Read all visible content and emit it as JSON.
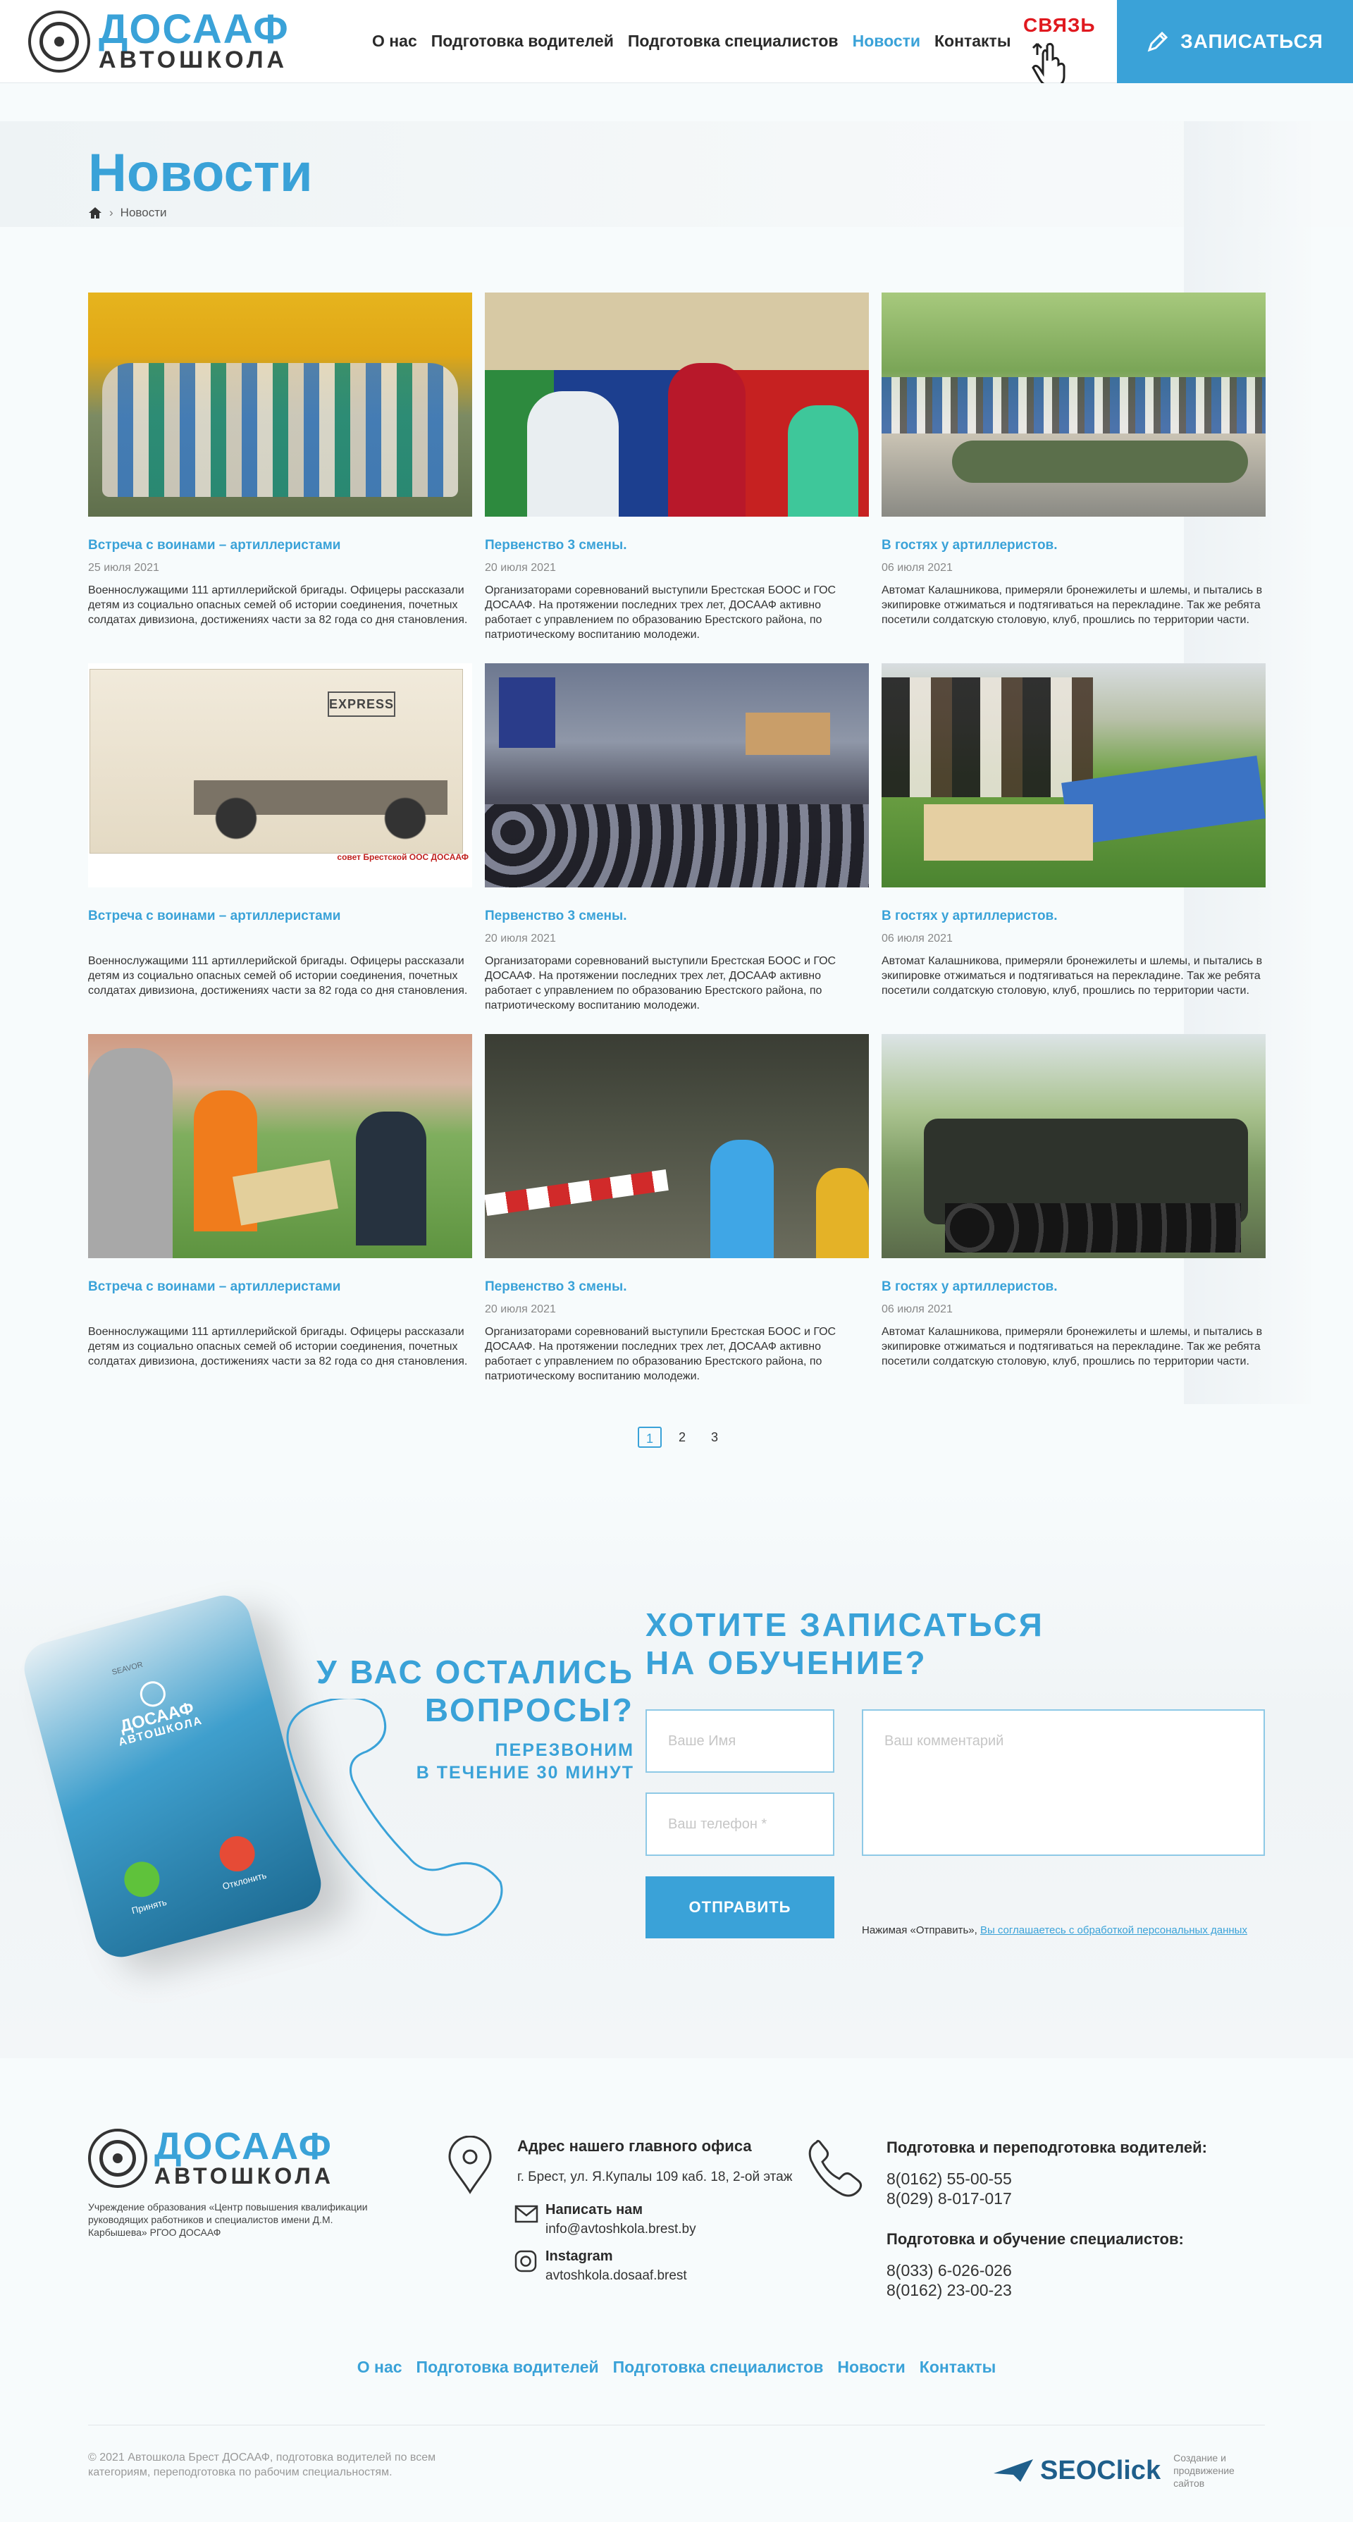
{
  "header": {
    "logo_top": "ДОСААФ",
    "logo_bottom": "АВТОШКОЛА",
    "nav": [
      "О нас",
      "Подготовка водителей",
      "Подготовка специалистов",
      "Новости",
      "Контакты"
    ],
    "contact_label": "СВЯЗЬ",
    "cta_label": "ЗАПИСАТЬСЯ"
  },
  "page": {
    "title": "Новости",
    "breadcrumb_current": "Новости"
  },
  "news": [
    {
      "title": "Встреча с воинами – артиллеристами",
      "date": "25 июля 2021",
      "text": "Военнослужащими 111 артиллерийской бригады. Офицеры рассказали детям из социально опасных семей об истории соединения, почетных солдатах дивизиона, достижениях части за 82 года со дня становления."
    },
    {
      "title": "Первенство 3 смены.",
      "date": "20 июля 2021",
      "text": "Организаторами соревнований выступили Брестская БООС и ГОС ДОСААФ. На протяжении последних трех лет, ДОСААФ активно работает с управлением по образованию Брестского района, по патриотическому воспитанию молодежи."
    },
    {
      "title": "В гостях у артиллеристов.",
      "date": "06 июля 2021",
      "text": "Автомат Калашникова, примеряли бронежилеты и шлемы, и пытались в экипировке отжиматься и подтягиваться на перекладине. Так же ребята посетили солдатскую столовую, клуб, прошлись по территории части."
    },
    {
      "title": "Встреча с воинами – артиллеристами",
      "date": "",
      "text": "Военнослужащими 111 артиллерийской бригады. Офицеры рассказали детям из социально опасных семей об истории соединения, почетных солдатах дивизиона, достижениях части за 82 года со дня становления."
    },
    {
      "title": "Первенство 3 смены.",
      "date": "20 июля 2021",
      "text": "Организаторами соревнований выступили Брестская БООС и ГОС ДОСААФ. На протяжении последних трех лет, ДОСААФ активно работает с управлением по образованию Брестского района, по патриотическому воспитанию молодежи."
    },
    {
      "title": "В гостях у артиллеристов.",
      "date": "06 июля 2021",
      "text": "Автомат Калашникова, примеряли бронежилеты и шлемы, и пытались в экипировке отжиматься и подтягиваться на перекладине. Так же ребята посетили солдатскую столовую, клуб, прошлись по территории части."
    },
    {
      "title": "Встреча с воинами – артиллеристами",
      "date": "",
      "text": "Военнослужащими 111 артиллерийской бригады. Офицеры рассказали детям из социально опасных семей об истории соединения, почетных солдатах дивизиона, достижениях части за 82 года со дня становления."
    },
    {
      "title": "Первенство 3 смены.",
      "date": "20 июля 2021",
      "text": "Организаторами соревнований выступили Брестская БООС и ГОС ДОСААФ. На протяжении последних трех лет, ДОСААФ активно работает с управлением по образованию Брестского района, по патриотическому воспитанию молодежи."
    },
    {
      "title": "В гостях у артиллеристов.",
      "date": "06 июля 2021",
      "text": "Автомат Калашникова, примеряли бронежилеты и шлемы, и пытались в экипировке отжиматься и подтягиваться на перекладине. Так же ребята посетили солдатскую столовую, клуб, прошлись по территории части."
    }
  ],
  "postcard": {
    "stamp": "EXPRESS",
    "caption": "совет Брестской ООС ДОСААФ"
  },
  "pagination": [
    "1",
    "2",
    "3"
  ],
  "callback": {
    "phone_label": "SEAVOR",
    "phone_logo_top": "ДОСААФ",
    "phone_logo_bottom": "АВТОШКОЛА",
    "accept": "Принять",
    "decline": "Отклонить",
    "question_line1": "У ВАС ОСТАЛИСЬ",
    "question_line2": "ВОПРОСЫ?",
    "sub_line1": "ПЕРЕЗВОНИМ",
    "sub_line2": "В ТЕЧЕНИЕ 30 МИНУТ"
  },
  "form": {
    "title_line1": "ХОТИТЕ ЗАПИСАТЬСЯ",
    "title_line2": "НА ОБУЧЕНИЕ?",
    "name_placeholder": "Ваше Имя",
    "phone_placeholder": "Ваш телефон *",
    "comment_placeholder": "Ваш комментарий",
    "submit": "ОТПРАВИТЬ",
    "consent_prefix": "Нажимая «Отправить», ",
    "consent_link": "Вы соглашаетесь с обработкой персональных данных"
  },
  "footer": {
    "logo_top": "ДОСААФ",
    "logo_bottom": "АВТОШКОЛА",
    "org": "Учреждение образования «Центр повышения квалификации руководящих работников и специалистов имени Д.М. Карбышева» РГОО ДОСААФ",
    "address_title": "Адрес нашего главного офиса",
    "address": "г. Брест, ул. Я.Купалы 109 каб. 18, 2-ой этаж",
    "mail_title": "Написать нам",
    "mail": "info@avtoshkola.brest.by",
    "insta_title": "Instagram",
    "insta": "avtoshkola.dosaaf.brest",
    "drivers_title": "Подготовка и переподготовка водителей:",
    "drivers_phones": [
      "8(0162) 55-00-55",
      "8(029) 8-017-017"
    ],
    "spec_title": "Подготовка и обучение специалистов:",
    "spec_phones": [
      "8(033) 6-026-026",
      "8(0162) 23-00-23"
    ],
    "nav": [
      "О нас",
      "Подготовка водителей",
      "Подготовка специалистов",
      "Новости",
      "Контакты"
    ],
    "copyright": "© 2021 Автошкола Брест ДОСААФ, подготовка водителей по всем категориям, переподготовка по рабочим специальностям.",
    "dev_name": "SEOClick",
    "dev_note": "Создание и продвижение сайтов"
  },
  "colors": {
    "accent": "#3aa2d8",
    "text": "#2a2a2a",
    "red": "#e0191f"
  }
}
